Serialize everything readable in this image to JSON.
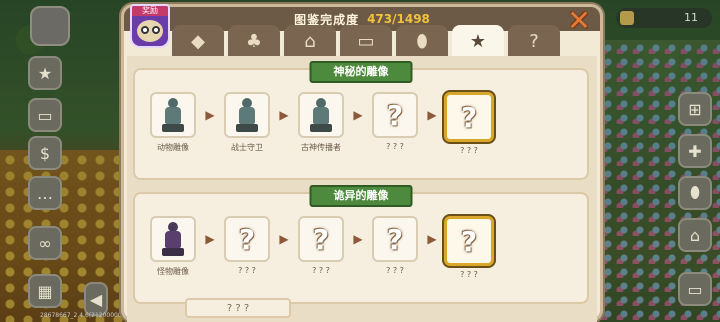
{
  "header": {
    "title": "图鉴完成度",
    "progress": "473/1498"
  },
  "avatar": {
    "badge": "奖励"
  },
  "tabs": [
    {
      "name": "gem-icon",
      "glyph": "◆",
      "active": false
    },
    {
      "name": "clover-icon",
      "glyph": "♣",
      "active": false
    },
    {
      "name": "house-icon",
      "glyph": "⌂",
      "active": false
    },
    {
      "name": "chest-icon",
      "glyph": "▭",
      "active": false
    },
    {
      "name": "egg-icon",
      "glyph": "⬮",
      "active": false
    },
    {
      "name": "star-icon",
      "glyph": "★",
      "active": true
    },
    {
      "name": "question-icon",
      "glyph": "?",
      "active": false
    }
  ],
  "sections": [
    {
      "title": "神秘的雕像",
      "items": [
        {
          "label": "动物雕像",
          "known": true,
          "style": "teal"
        },
        {
          "label": "战士守卫",
          "known": true,
          "style": "teal"
        },
        {
          "label": "古神传播者",
          "known": true,
          "style": "teal"
        },
        {
          "label": "? ? ?",
          "known": false
        },
        {
          "label": "? ? ?",
          "known": false,
          "gold": true
        }
      ]
    },
    {
      "title": "诡异的雕像",
      "items": [
        {
          "label": "怪物雕像",
          "known": true,
          "style": "dark"
        },
        {
          "label": "? ? ?",
          "known": false
        },
        {
          "label": "? ? ?",
          "known": false
        },
        {
          "label": "? ? ?",
          "known": false
        },
        {
          "label": "? ? ?",
          "known": false,
          "gold": true
        }
      ]
    }
  ],
  "next_section_title": "? ? ?",
  "hud": {
    "currency_value": "11",
    "version": "28678667_2.4.6(21200000033)"
  },
  "colors": {
    "accent_green": "#4e8a3e",
    "gold_frame": "#d9a82a",
    "header_bg": "#6d5a46",
    "progress_color": "#f0c23c"
  }
}
